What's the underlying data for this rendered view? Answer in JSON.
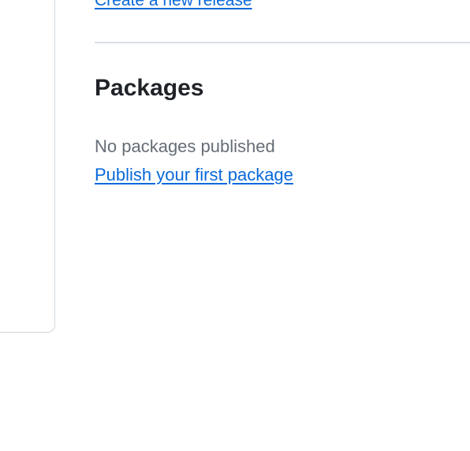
{
  "releases": {
    "create_link_label": "Create a new release"
  },
  "packages": {
    "heading": "Packages",
    "empty_text": "No packages published",
    "publish_link_label": "Publish your first package"
  },
  "colors": {
    "link": "#0969da",
    "muted_text": "#656d76",
    "heading_text": "#1f2328",
    "border": "#d0d7de"
  }
}
